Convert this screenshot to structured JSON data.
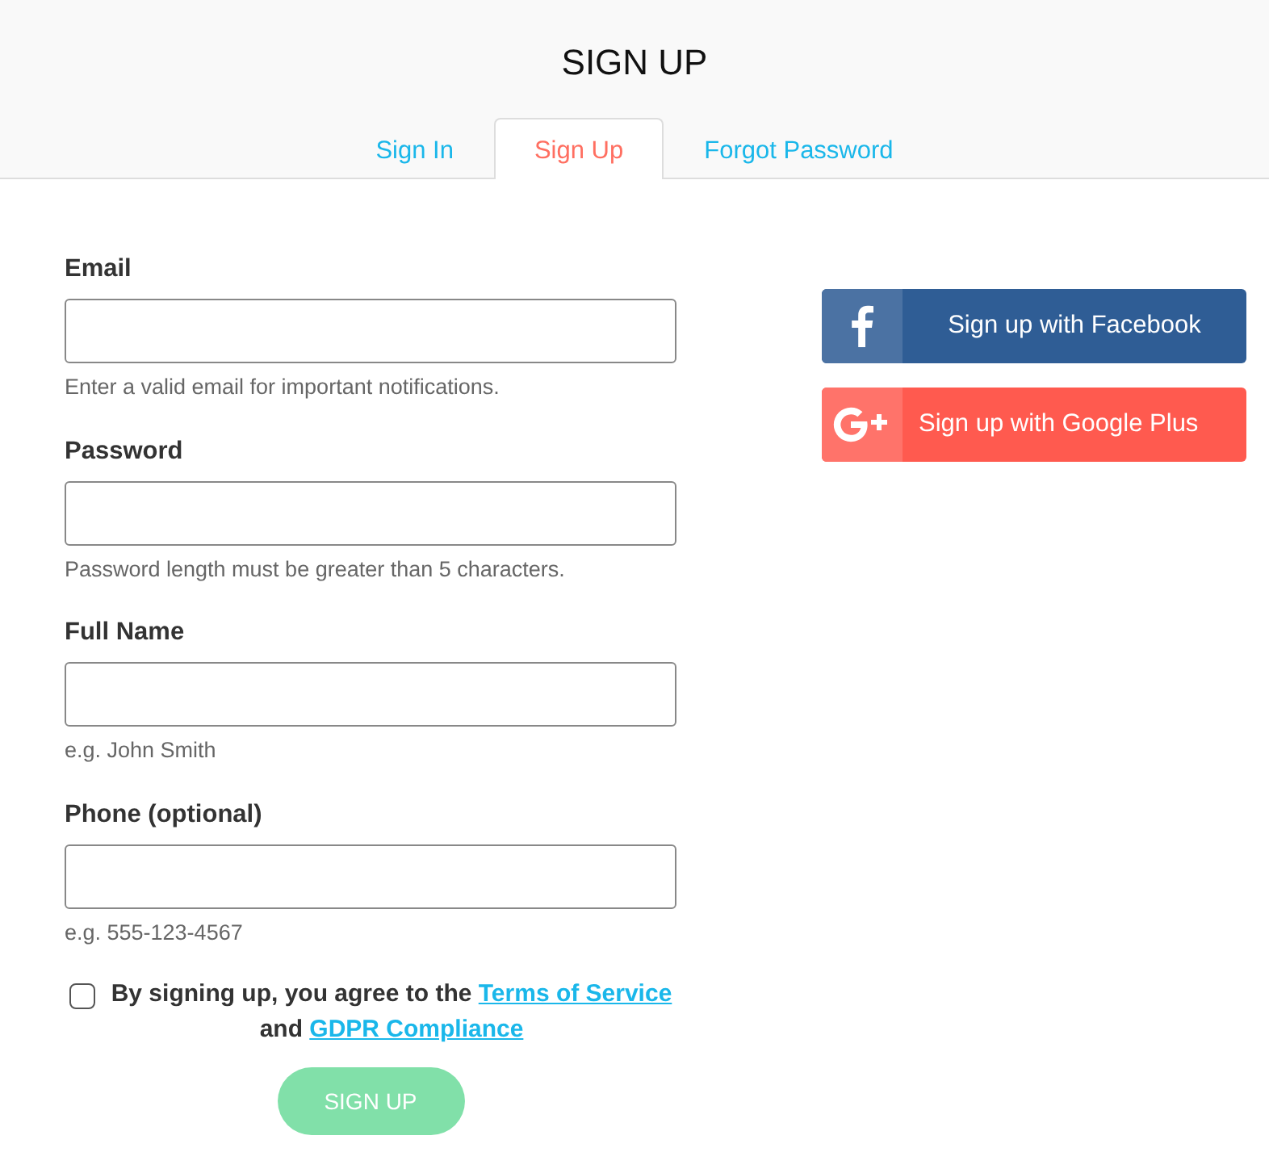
{
  "title": "SIGN UP",
  "tabs": [
    {
      "label": "Sign In",
      "selected": false
    },
    {
      "label": "Sign Up",
      "selected": true
    },
    {
      "label": "Forgot Password",
      "selected": false
    }
  ],
  "fields": [
    {
      "label": "Email",
      "help": "Enter a valid email for important notifications."
    },
    {
      "label": "Password",
      "help": "Password length must be greater than 5 characters."
    },
    {
      "label": "Full Name",
      "help": "e.g. John Smith"
    },
    {
      "label": "Phone (optional)",
      "help": "e.g. 555-123-4567"
    }
  ],
  "agreement": {
    "checked": false,
    "text_before": "By signing up, you agree to the",
    "link_1": "Terms of Service",
    "text_middle": "and",
    "link_2": "GDPR Compliance"
  },
  "submit": {
    "label": "SIGN UP",
    "disabled": true
  },
  "social_buttons": [
    {
      "kind": "facebook",
      "label": "Sign up with Facebook"
    },
    {
      "kind": "google",
      "label": "Sign up with Google Plus"
    }
  ]
}
